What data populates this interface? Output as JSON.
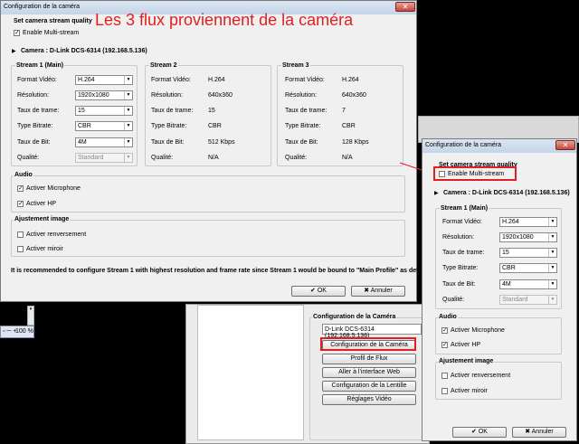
{
  "annotation": "Les 3 flux proviennent de la caméra",
  "win1": {
    "title": "Configuration de la caméra",
    "section_title": "Set camera stream quality",
    "multistream_label": "Enable Multi-stream",
    "camera": "Camera : D-Link DCS-6314 (192.168.5.136)",
    "stream1_title": "Stream 1 (Main)",
    "stream2_title": "Stream 2",
    "stream3_title": "Stream 3",
    "labels": {
      "format": "Format Vidéo:",
      "resolution": "Résolution:",
      "taux": "Taux de trame:",
      "type": "Type Bitrate:",
      "bit": "Taux de Bit:",
      "qualite": "Qualité:"
    },
    "s1": {
      "format": "H.264",
      "resolution": "1920x1080",
      "taux": "15",
      "type": "CBR",
      "bit": "4M",
      "qualite": "Standard"
    },
    "s2": {
      "format": "H.264",
      "resolution": "640x360",
      "taux": "15",
      "type": "CBR",
      "bit": "512 Kbps",
      "qualite": "N/A"
    },
    "s3": {
      "format": "H.264",
      "resolution": "640x360",
      "taux": "7",
      "type": "CBR",
      "bit": "128 Kbps",
      "qualite": "N/A"
    },
    "audio_title": "Audio",
    "mic": "Activer Microphone",
    "hp": "Activer HP",
    "image_title": "Ajustement image",
    "reverse": "Activer renversement",
    "mirror": "Activer miroir",
    "note": "It is recommended to configure Stream 1 with highest resolution and frame rate since Stream 1 would be bound to \"Main Profile\" as default.",
    "ok": "OK",
    "cancel": "Annuler"
  },
  "bg": {
    "zoom": "100 %",
    "group_title": "Configuration de la Caméra",
    "camera_field": "D-Link DCS-6314 (192.168.5.136)",
    "buttons": [
      "Configuration de la Caméra",
      "Profil de Flux",
      "Aller à l'interface Web",
      "Configuration de la Lentille",
      "Réglages Vidéo"
    ]
  },
  "win2": {
    "title": "Configuration de la caméra",
    "section_title": "Set camera stream quality",
    "multistream_label": "Enable Multi-stream",
    "camera": "Camera : D-Link DCS-6314 (192.168.5.136)",
    "stream1_title": "Stream 1 (Main)",
    "labels": {
      "format": "Format Vidéo:",
      "resolution": "Résolution:",
      "taux": "Taux de trame:",
      "type": "Type Bitrate:",
      "bit": "Taux de Bit:",
      "qualite": "Qualité:"
    },
    "s1": {
      "format": "H.264",
      "resolution": "1920x1080",
      "taux": "15",
      "type": "CBR",
      "bit": "4M",
      "qualite": "Standard"
    },
    "audio_title": "Audio",
    "mic": "Activer Microphone",
    "hp": "Activer HP",
    "image_title": "Ajustement image",
    "reverse": "Activer renversement",
    "mirror": "Activer miroir",
    "ok": "OK",
    "cancel": "Annuler"
  },
  "colors": {
    "annotation": "#e02020",
    "highlight": "#e02020",
    "titlebar": "#c9d8ea"
  }
}
